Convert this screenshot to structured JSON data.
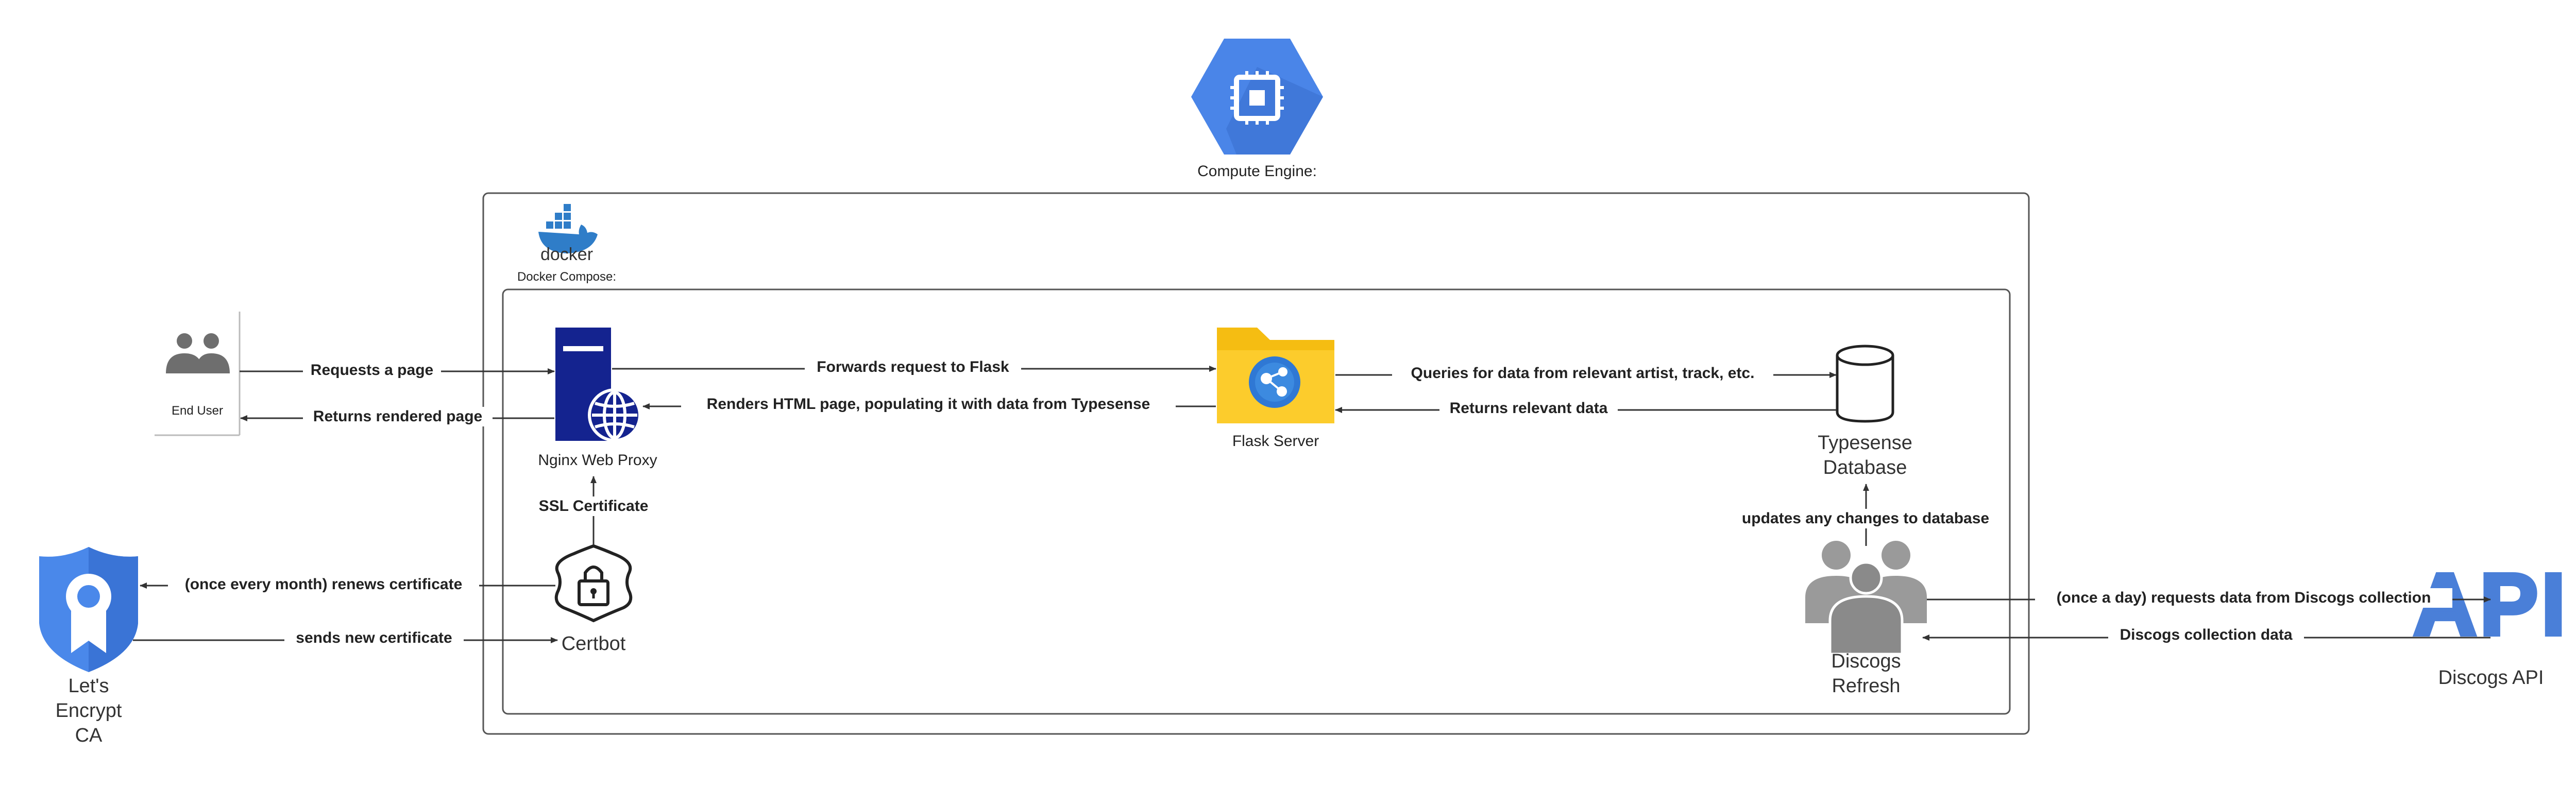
{
  "compute_engine": {
    "label": "Compute Engine:"
  },
  "docker": {
    "logo_text": "docker",
    "label": "Docker Compose:"
  },
  "nodes": {
    "end_user": "End User",
    "nginx": "Nginx Web Proxy",
    "flask": "Flask Server",
    "typesense": [
      "Typesense",
      "Database"
    ],
    "certbot": "Certbot",
    "letsencrypt": [
      "Let's",
      "Encrypt",
      "CA"
    ],
    "discogs_refresh": [
      "Discogs",
      "Refresh"
    ],
    "discogs_api": "Discogs API",
    "api_logo": "API"
  },
  "edges": {
    "requests_page": "Requests a page",
    "returns_rendered": "Returns rendered page",
    "forwards_flask": "Forwards request to Flask",
    "renders_html": "Renders HTML page, populating it with data from Typesense",
    "queries_data": "Queries for data from relevant artist, track, etc.",
    "returns_relevant": "Returns relevant data",
    "ssl_cert": "SSL Certificate",
    "renews_cert": "(once every month) renews certificate",
    "sends_cert": "sends new certificate",
    "updates_db": "updates any changes to database",
    "requests_discogs": "(once a day) requests data from Discogs collection",
    "discogs_data": "Discogs collection data"
  },
  "colors": {
    "gcp_blue": "#4a85e8",
    "navy": "#14238f",
    "folder": "#f5bd12",
    "azure": "#2f78d4",
    "people_gray": "#9a9a9a",
    "shield_blue": "#4a88ea",
    "api_blue": "#4a7fd8"
  }
}
